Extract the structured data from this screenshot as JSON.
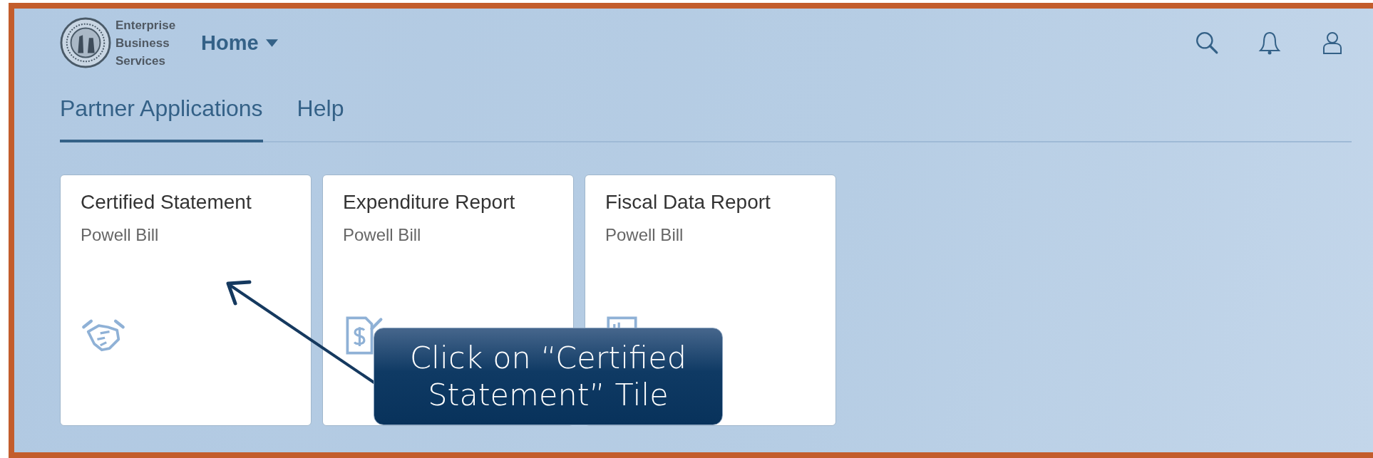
{
  "header": {
    "logo_text": [
      "Enterprise",
      "Business",
      "Services"
    ],
    "menu": {
      "label": "Home"
    }
  },
  "tabs": [
    {
      "label": "Partner Applications",
      "selected": true
    },
    {
      "label": "Help",
      "selected": false
    }
  ],
  "tiles": [
    {
      "title": "Certified Statement",
      "subtitle": "Powell Bill",
      "kind": "handshake"
    },
    {
      "title": "Expenditure Report",
      "subtitle": "Powell Bill",
      "kind": "invoice"
    },
    {
      "title": "Fiscal Data Report",
      "subtitle": "Powell Bill",
      "kind": "chart"
    }
  ],
  "callout": {
    "text": "Click on “Certified Statement” Tile"
  }
}
